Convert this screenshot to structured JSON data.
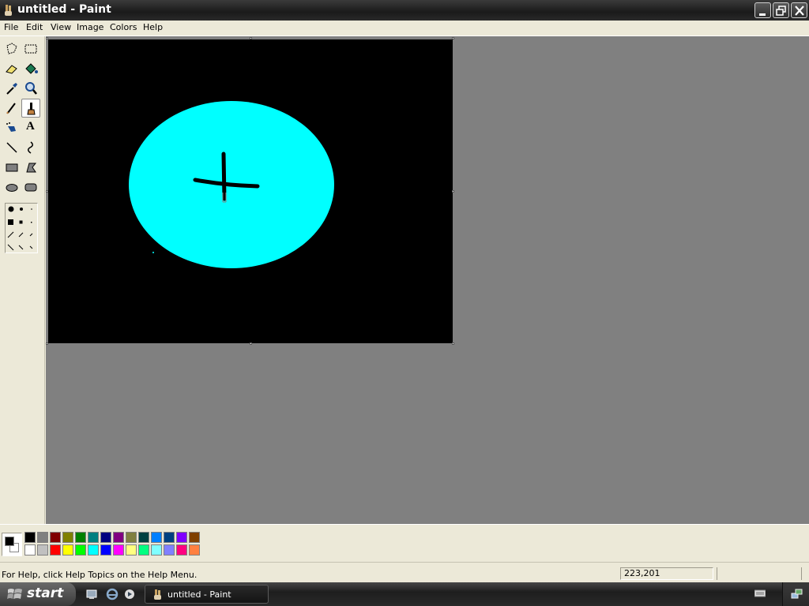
{
  "window": {
    "title": "untitled - Paint"
  },
  "menu": {
    "items": [
      "File",
      "Edit",
      "View",
      "Image",
      "Colors",
      "Help"
    ]
  },
  "toolbox": {
    "tools": [
      {
        "name": "free-form-select-icon"
      },
      {
        "name": "rectangle-select-icon"
      },
      {
        "name": "eraser-icon"
      },
      {
        "name": "fill-bucket-icon"
      },
      {
        "name": "color-picker-icon"
      },
      {
        "name": "magnifier-icon"
      },
      {
        "name": "pencil-icon"
      },
      {
        "name": "brush-icon",
        "active": true
      },
      {
        "name": "airbrush-icon"
      },
      {
        "name": "text-icon"
      },
      {
        "name": "line-icon"
      },
      {
        "name": "curve-icon"
      },
      {
        "name": "rectangle-icon"
      },
      {
        "name": "polygon-icon"
      },
      {
        "name": "ellipse-icon"
      },
      {
        "name": "rounded-rectangle-icon"
      }
    ],
    "text_tool_glyph": "A"
  },
  "canvas": {
    "background": "#000000",
    "ellipse_color": "#00ffff",
    "cross_color": "#000000"
  },
  "palette": {
    "foreground": "#000000",
    "background": "#ffffff",
    "top_row": [
      "#000000",
      "#808080",
      "#800000",
      "#808000",
      "#008000",
      "#008080",
      "#000080",
      "#800080",
      "#808040",
      "#004040",
      "#0080ff",
      "#004080",
      "#8000ff",
      "#804000"
    ],
    "bottom_row": [
      "#ffffff",
      "#c0c0c0",
      "#ff0000",
      "#ffff00",
      "#00ff00",
      "#00ffff",
      "#0000ff",
      "#ff00ff",
      "#ffff80",
      "#00ff80",
      "#80ffff",
      "#8080ff",
      "#ff0080",
      "#ff8040"
    ]
  },
  "status": {
    "help_text": "For Help, click Help Topics on the Help Menu.",
    "coordinates": "223,201"
  },
  "taskbar": {
    "start_label": "start",
    "task_label": "untitled - Paint"
  }
}
